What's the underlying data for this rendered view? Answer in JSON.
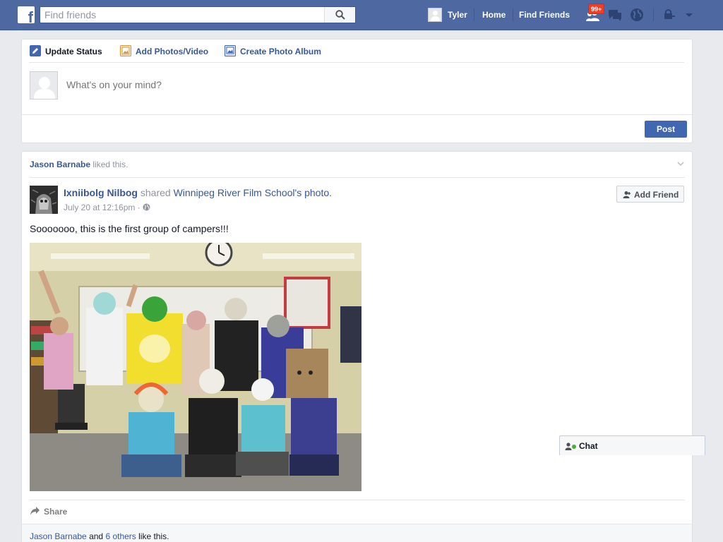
{
  "topbar": {
    "logo_letter": "f",
    "search_placeholder": "Find friends",
    "user_name": "Tyler",
    "home_label": "Home",
    "find_friends_label": "Find Friends",
    "friend_requests_badge": "99+",
    "icons": [
      "facebook-logo",
      "search-icon",
      "friend-requests-icon",
      "messages-icon",
      "notifications-globe-icon",
      "privacy-shortcuts-icon",
      "settings-dropdown-icon"
    ],
    "colors": {
      "bar": "#4e69a2",
      "badge": "#f03d25"
    }
  },
  "composer": {
    "tabs": [
      {
        "label": "Update Status",
        "icon": "pencil-icon"
      },
      {
        "label": "Add Photos/Video",
        "icon": "photo-icon"
      },
      {
        "label": "Create Photo Album",
        "icon": "album-icon"
      }
    ],
    "placeholder": "What's on your mind?",
    "post_label": "Post"
  },
  "story": {
    "context_actor": "Jason Barnabe",
    "context_action": " liked this.",
    "author": "Ixniibolg Nilbog",
    "shared_word": " shared ",
    "page_name": "Winnipeg River Film School",
    "page_suffix": "'s photo.",
    "timestamp": "July 20 at 12:16pm · ",
    "privacy_icon": "public-globe-icon",
    "add_friend_label": "Add Friend",
    "text": "Sooooooo, this is the first group of campers!!!",
    "share_label": "Share",
    "likes_name": "Jason Barnabe",
    "likes_and": " and ",
    "likes_others": "6 others",
    "likes_suffix": " like this."
  },
  "chat": {
    "label": "Chat"
  }
}
